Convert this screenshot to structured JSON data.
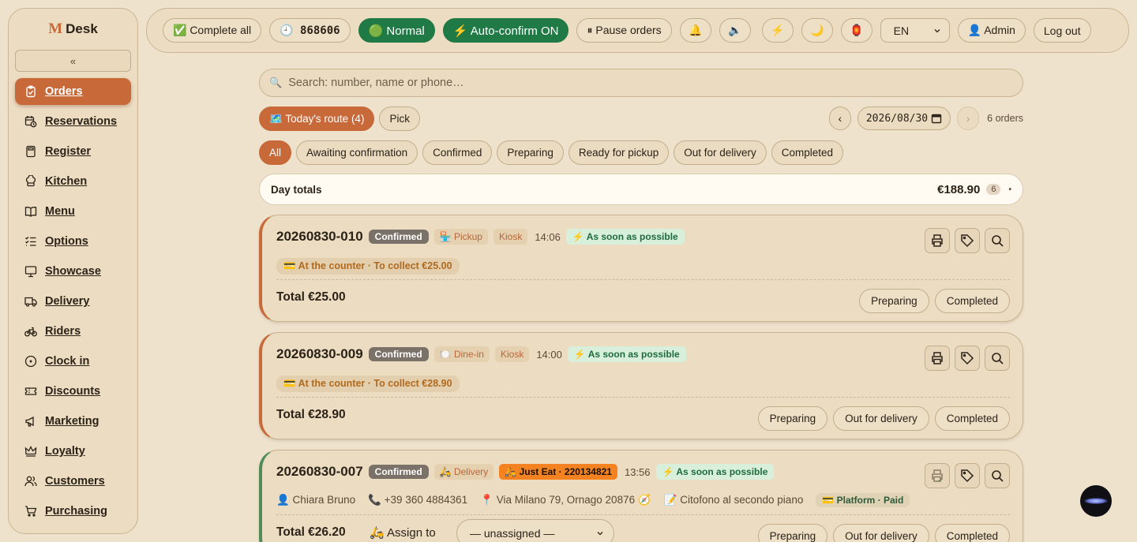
{
  "app": {
    "logo_mark": "M",
    "logo_text": "Desk"
  },
  "sidebar": {
    "collapse_label": "«",
    "items": [
      {
        "label": "Orders",
        "icon": "clipboard-icon",
        "active": true
      },
      {
        "label": "Reservations",
        "icon": "calendar-clock-icon"
      },
      {
        "label": "Register",
        "icon": "calculator-icon"
      },
      {
        "label": "Kitchen",
        "icon": "chef-hat-icon"
      },
      {
        "label": "Menu",
        "icon": "book-open-icon"
      },
      {
        "label": "Options",
        "icon": "checklist-icon"
      },
      {
        "label": "Showcase",
        "icon": "monitor-icon"
      },
      {
        "label": "Delivery",
        "icon": "truck-icon"
      },
      {
        "label": "Riders",
        "icon": "bicycle-icon"
      },
      {
        "label": "Clock in",
        "icon": "clock-icon"
      },
      {
        "label": "Discounts",
        "icon": "ticket-icon"
      },
      {
        "label": "Marketing",
        "icon": "megaphone-icon"
      },
      {
        "label": "Loyalty",
        "icon": "crown-icon"
      },
      {
        "label": "Customers",
        "icon": "users-icon"
      },
      {
        "label": "Purchasing",
        "icon": "cart-icon"
      }
    ]
  },
  "topbar": {
    "complete_all": "✅ Complete all",
    "counter": "🕘 868606",
    "mode": "🟢 Normal",
    "auto_confirm": "⚡ Auto-confirm ON",
    "pause_orders": "⏸ Pause orders",
    "language": "EN",
    "admin": "👤 Admin",
    "logout": "Log out"
  },
  "search": {
    "placeholder": "Search: number, name or phone…"
  },
  "route": {
    "today": "🗺️ Today's route (4)",
    "pick": "Pick"
  },
  "date": {
    "prev": "‹",
    "value": "2026/08/30",
    "next": "›",
    "count": "6 orders"
  },
  "filters": [
    "All",
    "Awaiting confirmation",
    "Confirmed",
    "Preparing",
    "Ready for pickup",
    "Out for delivery",
    "Completed"
  ],
  "day_totals": {
    "label": "Day totals",
    "amount": "€188.90",
    "count": "6",
    "dot": "•"
  },
  "orders": [
    {
      "number": "20260830-010",
      "status": "Confirmed",
      "type": "🏪 Pickup",
      "channel": "Kiosk",
      "time": "14:06",
      "asap": "⚡ As soon as possible",
      "payment": "💳 At the counter · To collect €25.00",
      "total": "Total €25.00",
      "actions": [
        "Preparing",
        "Completed"
      ]
    },
    {
      "number": "20260830-009",
      "status": "Confirmed",
      "type": "🍽️ Dine-in",
      "channel": "Kiosk",
      "time": "14:00",
      "asap": "⚡ As soon as possible",
      "payment": "💳 At the counter · To collect €28.90",
      "total": "Total €28.90",
      "actions": [
        "Preparing",
        "Out for delivery",
        "Completed"
      ]
    },
    {
      "number": "20260830-007",
      "status": "Confirmed",
      "type": "🛵 Delivery",
      "platform_tag": "🛵 Just Eat · 220134821",
      "time": "13:56",
      "asap": "⚡ As soon as possible",
      "customer": "👤 Chiara Bruno",
      "phone": "📞 +39 360 4884361",
      "address": "📍 Via Milano 79, Ornago 20876 🧭",
      "note": "📝 Citofono al secondo piano",
      "platform": "💳 Platform · Paid",
      "total": "Total €26.20",
      "assign_label": "🛵 Assign to",
      "assign_value": "— unassigned —",
      "actions": [
        "Preparing",
        "Out for delivery",
        "Completed"
      ]
    }
  ],
  "colors": {
    "accent": "#c8693a",
    "green": "#1f7a45",
    "background": "#efe2cc",
    "just_eat": "#f58220"
  }
}
